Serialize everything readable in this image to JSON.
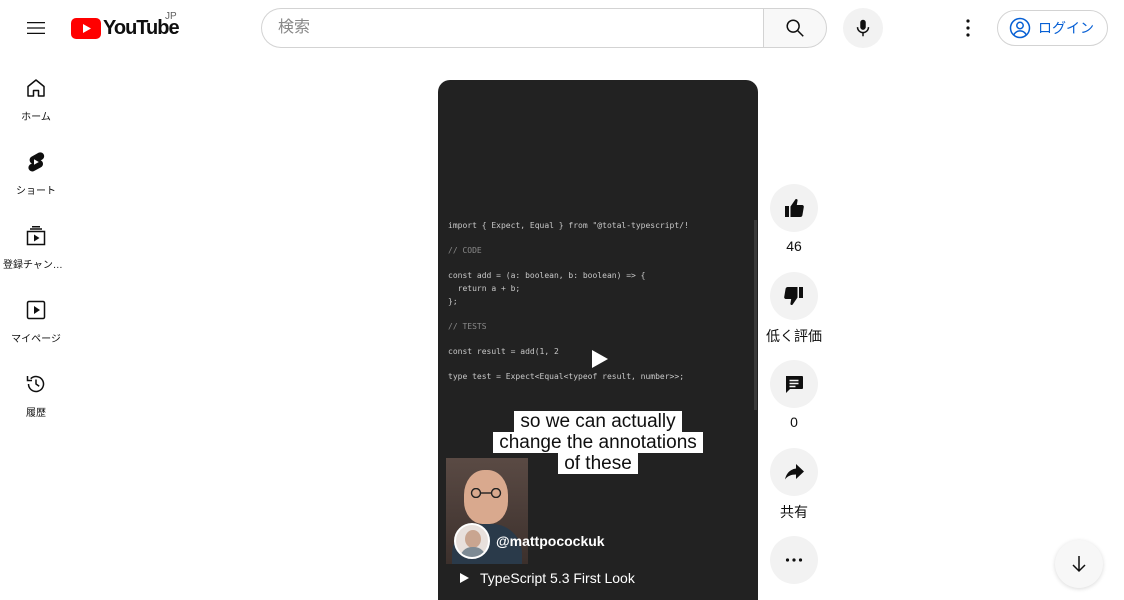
{
  "header": {
    "logo_text": "YouTube",
    "region": "JP",
    "search_placeholder": "検索",
    "login_label": "ログイン"
  },
  "sidebar": {
    "items": [
      {
        "label": "ホーム",
        "icon": "home-icon"
      },
      {
        "label": "ショート",
        "icon": "shorts-icon"
      },
      {
        "label": "登録チャンネル",
        "icon": "subscriptions-icon"
      },
      {
        "label": "マイページ",
        "icon": "library-icon"
      },
      {
        "label": "履歴",
        "icon": "history-icon"
      }
    ]
  },
  "player": {
    "code_lines": [
      "import { Expect, Equal } from \"@total-typescript/!",
      "// CODE",
      "const add = (a: boolean, b: boolean) => {",
      "  return a + b;",
      "};",
      "// TESTS",
      "const result = add(1, 2",
      "type test = Expect<Equal<typeof result, number>>;"
    ],
    "caption_lines": [
      "so we can actually",
      "change the annotations",
      "of these"
    ],
    "channel_handle": "@mattpocockuk",
    "video_title": "TypeScript 5.3 First Look"
  },
  "actions": {
    "like_count": "46",
    "dislike_label": "低く評価",
    "comment_count": "0",
    "share_label": "共有"
  },
  "colors": {
    "brand_red": "#ff0000",
    "link_blue": "#065fd4",
    "player_bg": "#222222"
  }
}
